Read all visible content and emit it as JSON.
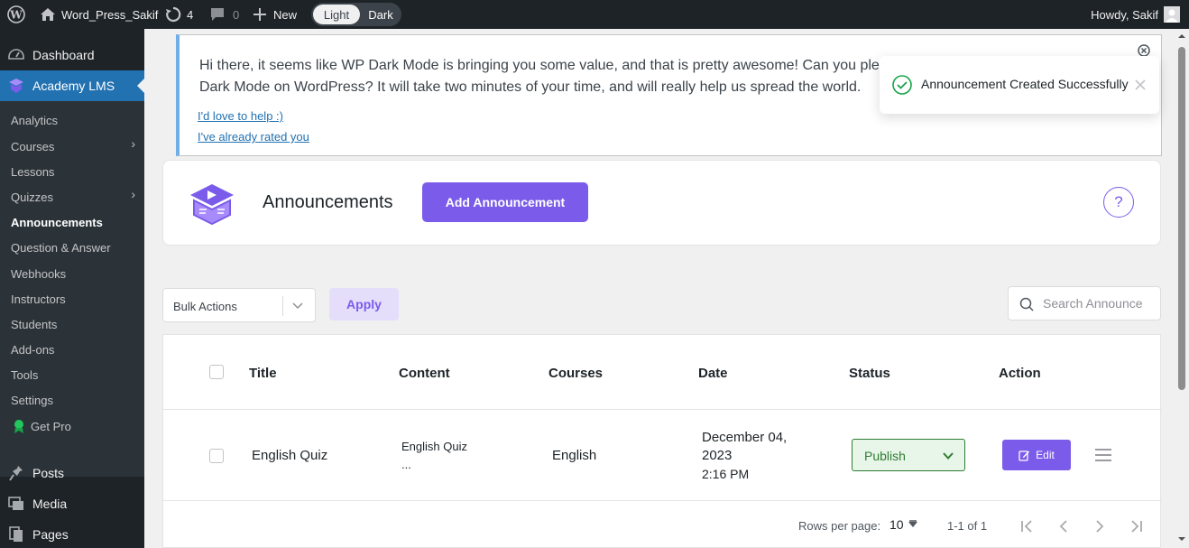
{
  "admin_bar": {
    "site_name": "Word_Press_Sakif",
    "updates_count": "4",
    "comments_count": "0",
    "new_label": "New",
    "toggle_light": "Light",
    "toggle_dark": "Dark",
    "greeting": "Howdy, Sakif"
  },
  "sidebar": {
    "top_items": [
      {
        "label": "Dashboard"
      },
      {
        "label": "Academy LMS"
      }
    ],
    "sub_items": [
      {
        "label": "Analytics"
      },
      {
        "label": "Courses"
      },
      {
        "label": "Lessons"
      },
      {
        "label": "Quizzes"
      },
      {
        "label": "Announcements"
      },
      {
        "label": "Question & Answer"
      },
      {
        "label": "Webhooks"
      },
      {
        "label": "Instructors"
      },
      {
        "label": "Students"
      },
      {
        "label": "Add-ons"
      },
      {
        "label": "Tools"
      },
      {
        "label": "Settings"
      },
      {
        "label": "Get Pro"
      }
    ],
    "bottom_items": [
      {
        "label": "Posts"
      },
      {
        "label": "Media"
      },
      {
        "label": "Pages"
      }
    ]
  },
  "notice": {
    "line1": "Hi there, it seems like WP Dark Mode is bringing you some value, and that is pretty awesome! Can you please",
    "line2": "Dark Mode on WordPress? It will take two minutes of your time, and will really help us spread the world.",
    "link_help": "I'd love to help :)",
    "link_rated": "I've already rated you"
  },
  "toast": {
    "message": "Announcement Created Successfully"
  },
  "page_header": {
    "title": "Announcements",
    "add_button": "Add Announcement",
    "help_label": "?"
  },
  "toolbar": {
    "bulk_actions": "Bulk Actions",
    "apply": "Apply",
    "search_placeholder": "Search Announce"
  },
  "table": {
    "columns": [
      "Title",
      "Content",
      "Courses",
      "Date",
      "Status",
      "Action"
    ],
    "rows": [
      {
        "title": "English Quiz",
        "content_line1": "English Quiz",
        "content_line2": "...",
        "course": "English",
        "date_line1": "December 04,",
        "date_line2": "2023",
        "date_line3": "2:16 PM",
        "status": "Publish",
        "action": "Edit"
      }
    ]
  },
  "pagination": {
    "rows_per_page_label": "Rows per page:",
    "rows_per_page_value": "10",
    "range": "1-1 of 1"
  },
  "colors": {
    "accent": "#7b5cea",
    "wp_dark": "#1d2327",
    "wp_blue": "#2271b1",
    "publish_green": "#2e7d32"
  }
}
